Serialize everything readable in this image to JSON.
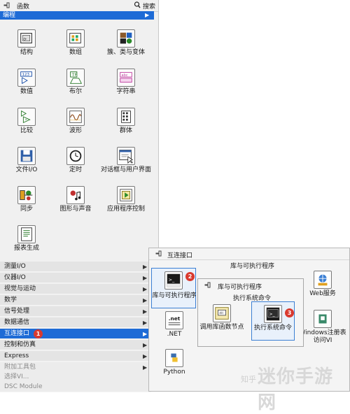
{
  "titlebar": {
    "title": "函数",
    "search_label": "搜索"
  },
  "category_header": "编程",
  "programming_tiles": [
    {
      "label": "结构",
      "icon": "structure-icon"
    },
    {
      "label": "数组",
      "icon": "array-icon"
    },
    {
      "label": "簇、类与变体",
      "icon": "cluster-class-variant-icon"
    },
    {
      "label": "数值",
      "icon": "numeric-icon"
    },
    {
      "label": "布尔",
      "icon": "boolean-icon"
    },
    {
      "label": "字符串",
      "icon": "string-icon"
    },
    {
      "label": "比较",
      "icon": "comparison-icon"
    },
    {
      "label": "波形",
      "icon": "waveform-icon"
    },
    {
      "label": "群体",
      "icon": "group-icon"
    },
    {
      "label": "文件I/O",
      "icon": "file-io-icon"
    },
    {
      "label": "定时",
      "icon": "timing-icon"
    },
    {
      "label": "对话框与用户界面",
      "icon": "dialog-ui-icon"
    },
    {
      "label": "同步",
      "icon": "synchronization-icon"
    },
    {
      "label": "图形与声音",
      "icon": "graphics-sound-icon"
    },
    {
      "label": "应用程序控制",
      "icon": "app-control-icon"
    },
    {
      "label": "报表生成",
      "icon": "report-generation-icon"
    }
  ],
  "categories": [
    {
      "label": "测量I/O"
    },
    {
      "label": "仪器I/O"
    },
    {
      "label": "视觉与运动"
    },
    {
      "label": "数学"
    },
    {
      "label": "信号处理"
    },
    {
      "label": "数据通信"
    },
    {
      "label": "互连接口",
      "selected": true,
      "badge": "1"
    },
    {
      "label": "控制和仿真"
    },
    {
      "label": "Express"
    },
    {
      "label": "附加工具包"
    },
    {
      "label": "选择VI..."
    },
    {
      "label": "DSC Module"
    }
  ],
  "interconnect_panel": {
    "title": "互连接口",
    "top_label": "库与可执行程序",
    "tiles": [
      {
        "label": "库与可执行程序",
        "badge": "2"
      },
      {
        "label": ".NET"
      },
      {
        "label": "Python"
      },
      {
        "label": "Web服务"
      },
      {
        "label": "Windows注册表访问VI"
      }
    ]
  },
  "library_panel": {
    "title": "库与可执行程序",
    "subtitle": "执行系统命令",
    "tiles": [
      {
        "label": "调用库函数节点"
      },
      {
        "label": "执行系统命令",
        "badge": "3"
      }
    ]
  },
  "watermark": {
    "text": "迷你手游网",
    "small": "知乎"
  }
}
